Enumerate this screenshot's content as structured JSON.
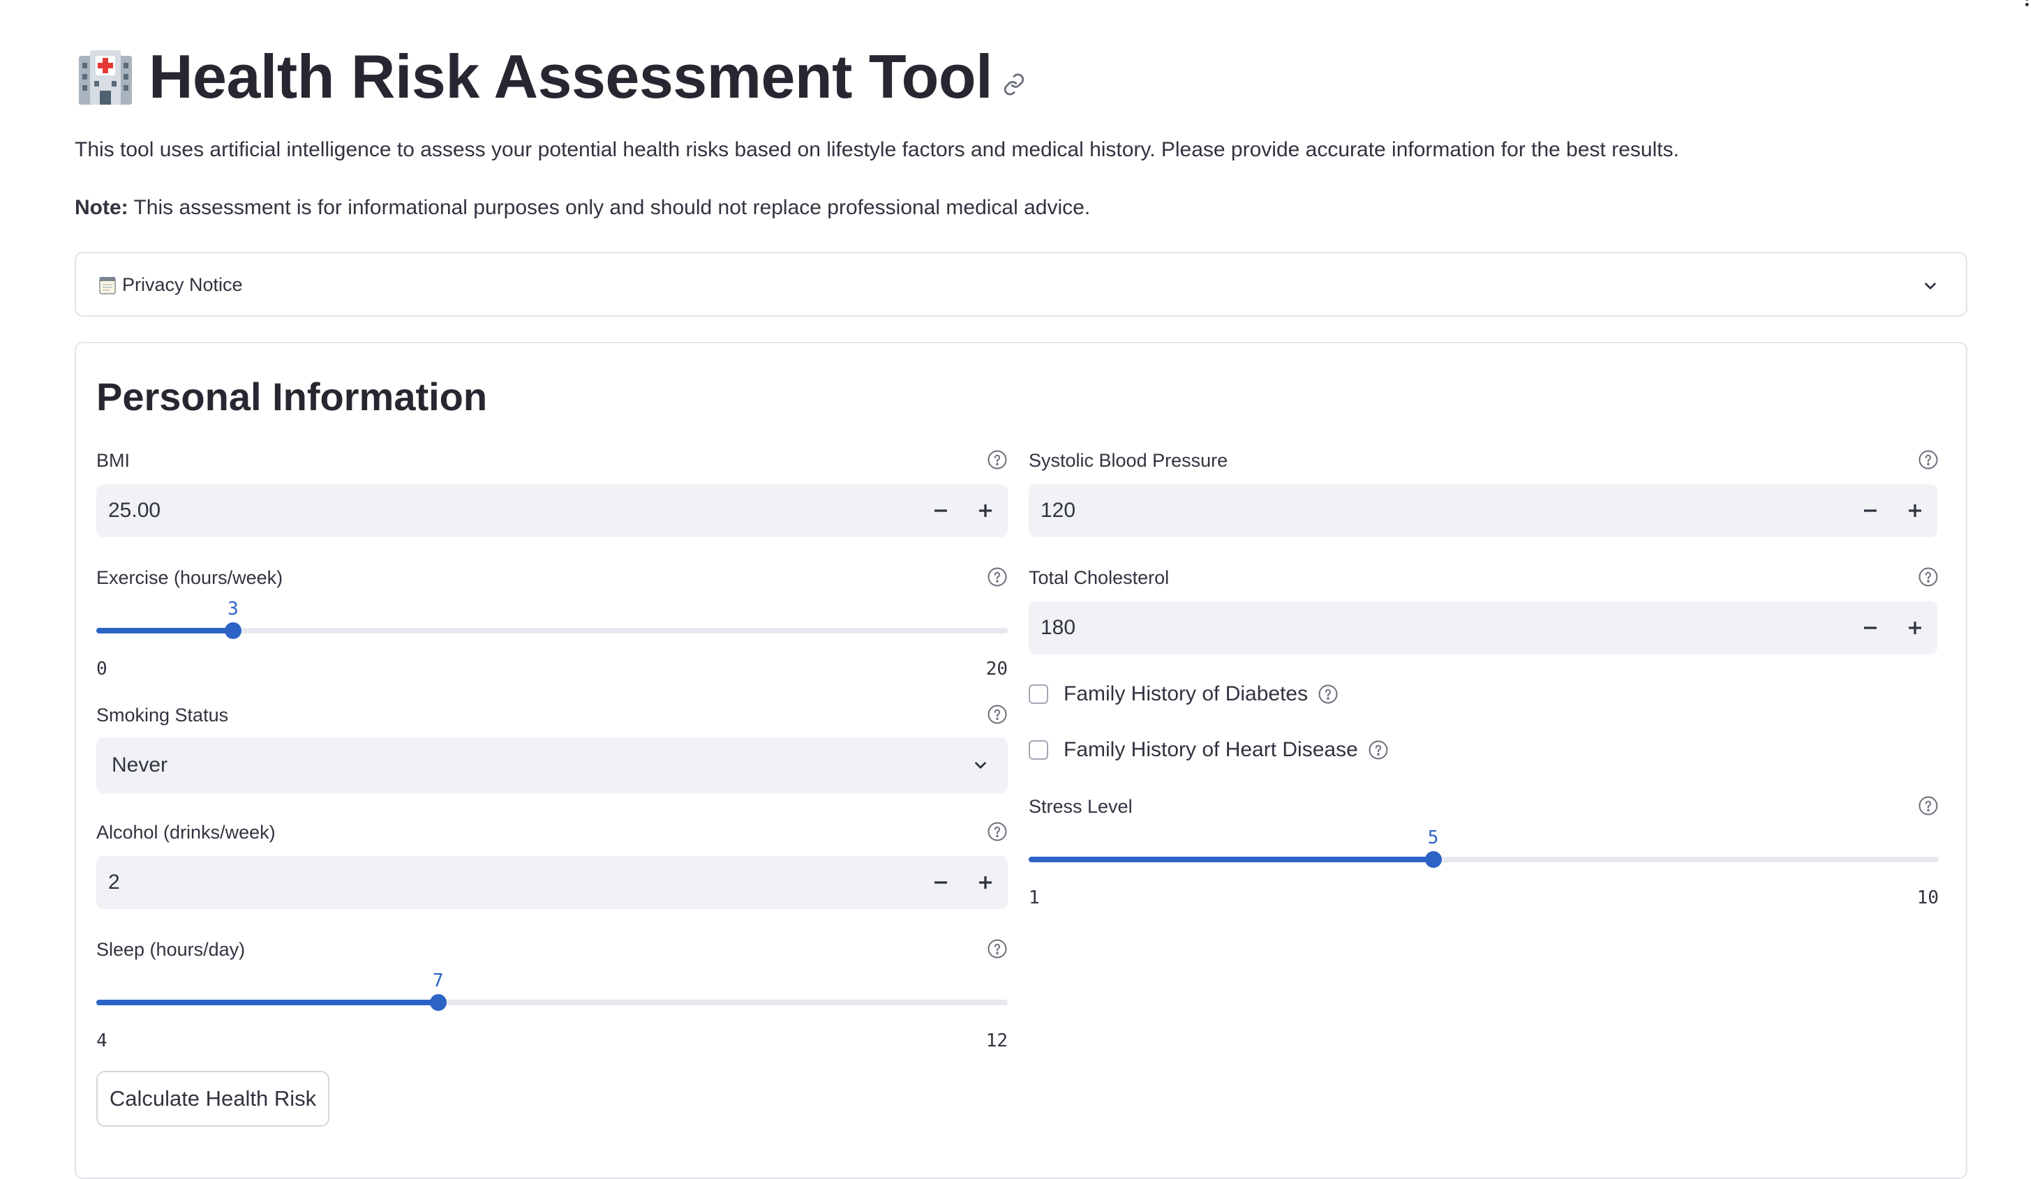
{
  "header": {
    "title": "Health Risk Assessment Tool",
    "intro": "This tool uses artificial intelligence to assess your potential health risks based on lifestyle factors and medical history. Please provide accurate information for the best results.",
    "note_bold": "Note:",
    "note_text": " This assessment is for informational purposes only and should not replace professional medical advice."
  },
  "privacy": {
    "label": "Privacy Notice",
    "icon": "notepad-icon",
    "expanded": false
  },
  "form": {
    "section_title": "Personal Information",
    "bmi": {
      "label": "BMI",
      "value": "25.00"
    },
    "exercise": {
      "label": "Exercise (hours/week)",
      "value": 3,
      "min": 0,
      "max": 20,
      "value_text": "3",
      "min_text": "0",
      "max_text": "20"
    },
    "smoking": {
      "label": "Smoking Status",
      "value": "Never"
    },
    "alcohol": {
      "label": "Alcohol (drinks/week)",
      "value": "2"
    },
    "sleep": {
      "label": "Sleep (hours/day)",
      "value": 7,
      "min": 4,
      "max": 12,
      "value_text": "7",
      "min_text": "4",
      "max_text": "12"
    },
    "systolic": {
      "label": "Systolic Blood Pressure",
      "value": "120"
    },
    "cholesterol": {
      "label": "Total Cholesterol",
      "value": "180"
    },
    "family_diabetes": {
      "label": "Family History of Diabetes",
      "checked": false
    },
    "family_heart": {
      "label": "Family History of Heart Disease",
      "checked": false
    },
    "stress": {
      "label": "Stress Level",
      "value": 5,
      "min": 1,
      "max": 10,
      "value_text": "5",
      "min_text": "1",
      "max_text": "10"
    },
    "calculate_label": "Calculate Health Risk"
  },
  "colors": {
    "accent": "#2c64c6",
    "input_bg": "#f0f2f6",
    "text": "#31333f",
    "border": "#e3e4e8"
  }
}
